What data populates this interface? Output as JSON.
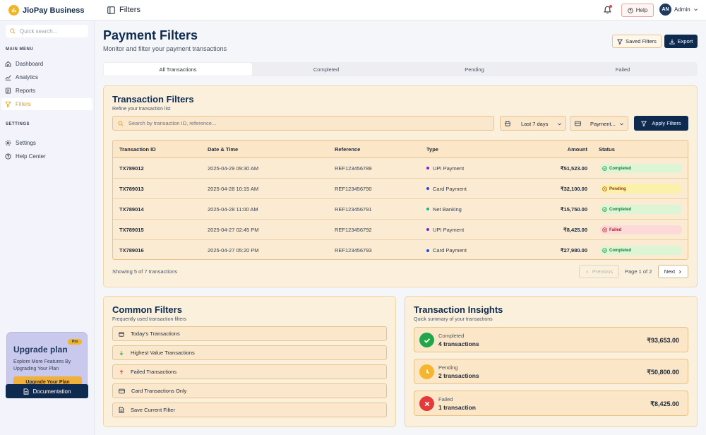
{
  "topbar": {
    "brand": "JioPay Business",
    "page_title": "Filters",
    "help_label": "Help",
    "user_initials": "AN",
    "user_name": "Admin"
  },
  "sidebar": {
    "search_placeholder": "Quick search...",
    "main_menu_label": "MAIN MENU",
    "main_items": [
      {
        "label": "Dashboard",
        "icon": "home-icon"
      },
      {
        "label": "Analytics",
        "icon": "analytics-icon"
      },
      {
        "label": "Reports",
        "icon": "reports-icon"
      },
      {
        "label": "Filters",
        "icon": "filter-icon",
        "active": true
      }
    ],
    "settings_label": "SETTINGS",
    "settings_items": [
      {
        "label": "Settings",
        "icon": "gear-icon"
      },
      {
        "label": "Help Center",
        "icon": "help-icon"
      }
    ],
    "upgrade": {
      "title": "Upgrade plan",
      "badge": "Pro",
      "description": "Explore More Features By Upgrading Your Plan",
      "button": "Upgrade Your Plan"
    },
    "documentation": "Documentation"
  },
  "header": {
    "title": "Payment Filters",
    "subtitle": "Monitor and filter your payment transactions",
    "saved_filters": "Saved Filters",
    "export": "Export"
  },
  "tabs": [
    {
      "label": "All Transactions",
      "active": true
    },
    {
      "label": "Completed"
    },
    {
      "label": "Pending"
    },
    {
      "label": "Failed"
    }
  ],
  "filters_card": {
    "title": "Transaction Filters",
    "subtitle": "Refine your transaction list",
    "search_placeholder": "Search by transaction ID, reference...",
    "date_select": "Last 7 days",
    "payment_select": "Payment...",
    "apply": "Apply Filters"
  },
  "table": {
    "headers": [
      "Transaction ID",
      "Date & Time",
      "Reference",
      "Type",
      "Amount",
      "Status"
    ],
    "rows": [
      {
        "id": "TX789012",
        "date": "2025-04-29 09:30 AM",
        "ref": "REF123456789",
        "type": "UPI Payment",
        "amount": "₹51,523.00",
        "status": "Completed"
      },
      {
        "id": "TX789013",
        "date": "2025-04-28 10:15 AM",
        "ref": "REF123456790",
        "type": "Card Payment",
        "amount": "₹32,100.00",
        "status": "Pending"
      },
      {
        "id": "TX789014",
        "date": "2025-04-28 11:00 AM",
        "ref": "REF123456791",
        "type": "Net Banking",
        "amount": "₹15,750.00",
        "status": "Completed"
      },
      {
        "id": "TX789015",
        "date": "2025-04-27 02:45 PM",
        "ref": "REF123456792",
        "type": "UPI Payment",
        "amount": "₹8,425.00",
        "status": "Failed"
      },
      {
        "id": "TX789016",
        "date": "2025-04-27 05:20 PM",
        "ref": "REF123456793",
        "type": "Card Payment",
        "amount": "₹27,980.00",
        "status": "Completed"
      }
    ],
    "showing": "Showing 5 of 7 transactions",
    "previous": "Previous",
    "page_info": "Page 1 of 2",
    "next": "Next"
  },
  "common_filters": {
    "title": "Common Filters",
    "subtitle": "Frequently used transaction filters",
    "items": [
      {
        "label": "Today's Transactions",
        "icon": "calendar-icon"
      },
      {
        "label": "Highest Value Transactions",
        "icon": "arrow-down-icon"
      },
      {
        "label": "Failed Transactions",
        "icon": "arrow-up-icon"
      },
      {
        "label": "Card Transactions Only",
        "icon": "card-icon"
      },
      {
        "label": "Save Current Filter",
        "icon": "document-icon"
      }
    ]
  },
  "insights": {
    "title": "Transaction Insights",
    "subtitle": "Quick summary of your transactions",
    "items": [
      {
        "label": "Completed",
        "count": "4 transactions",
        "amount": "₹93,653.00",
        "icon": "check-icon"
      },
      {
        "label": "Pending",
        "count": "2 transactions",
        "amount": "₹50,800.00",
        "icon": "clock-icon"
      },
      {
        "label": "Failed",
        "count": "1 transaction",
        "amount": "₹8,425.00",
        "icon": "x-icon"
      }
    ]
  },
  "colors": {
    "navy": "#0f2a4f",
    "accent": "#f0b429",
    "card_bg": "#fbf0dc",
    "completed": "#22c55e",
    "pending": "#f5b52e",
    "failed": "#ef4444"
  }
}
